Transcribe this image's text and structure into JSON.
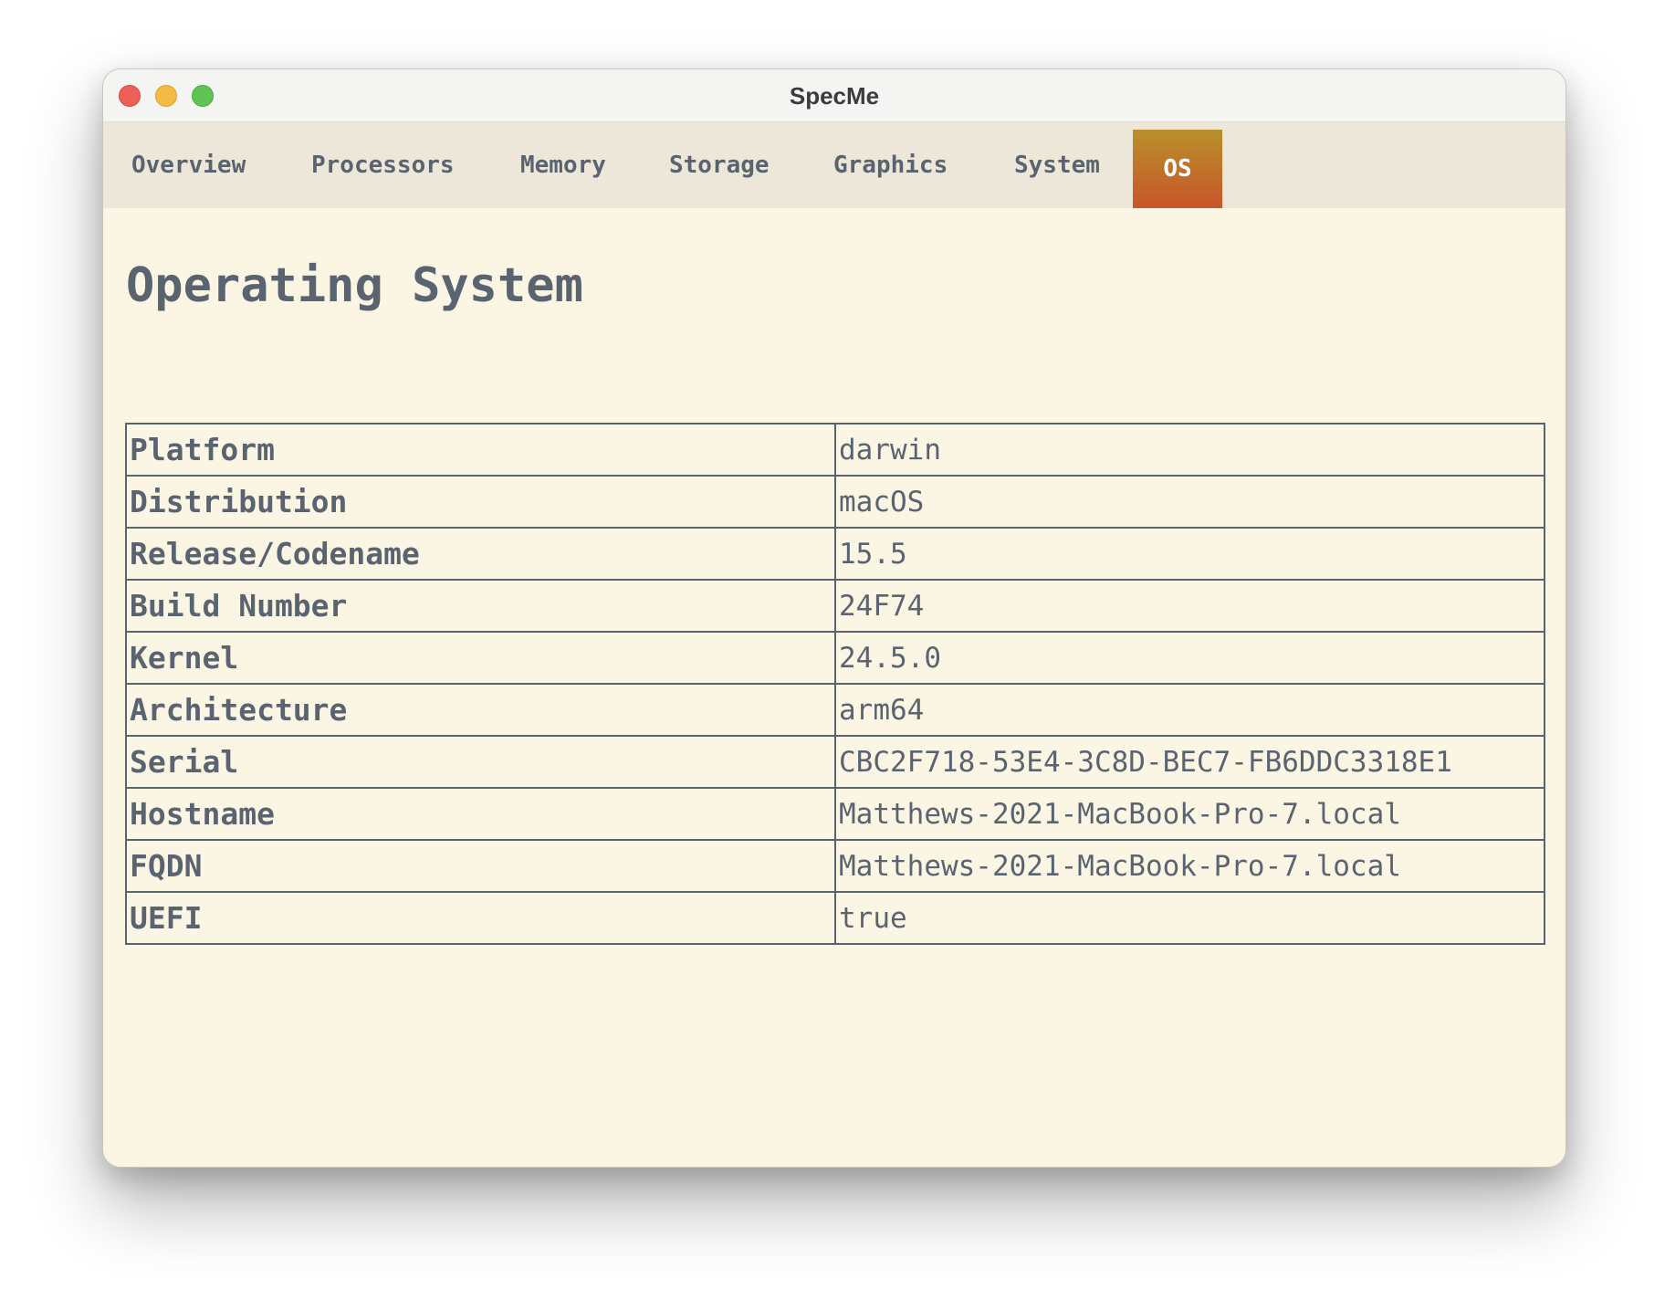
{
  "window": {
    "title": "SpecMe"
  },
  "tabs": [
    {
      "label": "Overview",
      "active": false
    },
    {
      "label": "Processors",
      "active": false
    },
    {
      "label": "Memory",
      "active": false
    },
    {
      "label": "Storage",
      "active": false
    },
    {
      "label": "Graphics",
      "active": false
    },
    {
      "label": "System",
      "active": false
    },
    {
      "label": "OS",
      "active": true
    }
  ],
  "main": {
    "title": "Operating System",
    "rows": [
      {
        "key": "Platform",
        "value": "darwin"
      },
      {
        "key": "Distribution",
        "value": "macOS"
      },
      {
        "key": "Release/Codename",
        "value": "15.5"
      },
      {
        "key": "Build Number",
        "value": "24F74"
      },
      {
        "key": "Kernel",
        "value": "24.5.0"
      },
      {
        "key": "Architecture",
        "value": "arm64"
      },
      {
        "key": "Serial",
        "value": "CBC2F718-53E4-3C8D-BEC7-FB6DDC3318E1"
      },
      {
        "key": "Hostname",
        "value": "Matthews-2021-MacBook-Pro-7.local"
      },
      {
        "key": "FQDN",
        "value": "Matthews-2021-MacBook-Pro-7.local"
      },
      {
        "key": "UEFI",
        "value": "true"
      }
    ]
  },
  "colors": {
    "text": "#5a6470",
    "background": "#fbf5e4",
    "tabbar": "#ede7d9",
    "active_tab_top": "#b8902b",
    "active_tab_bottom": "#c9552a",
    "close": "#ee5f57",
    "minimize": "#f4bb44",
    "zoom": "#60c454"
  }
}
